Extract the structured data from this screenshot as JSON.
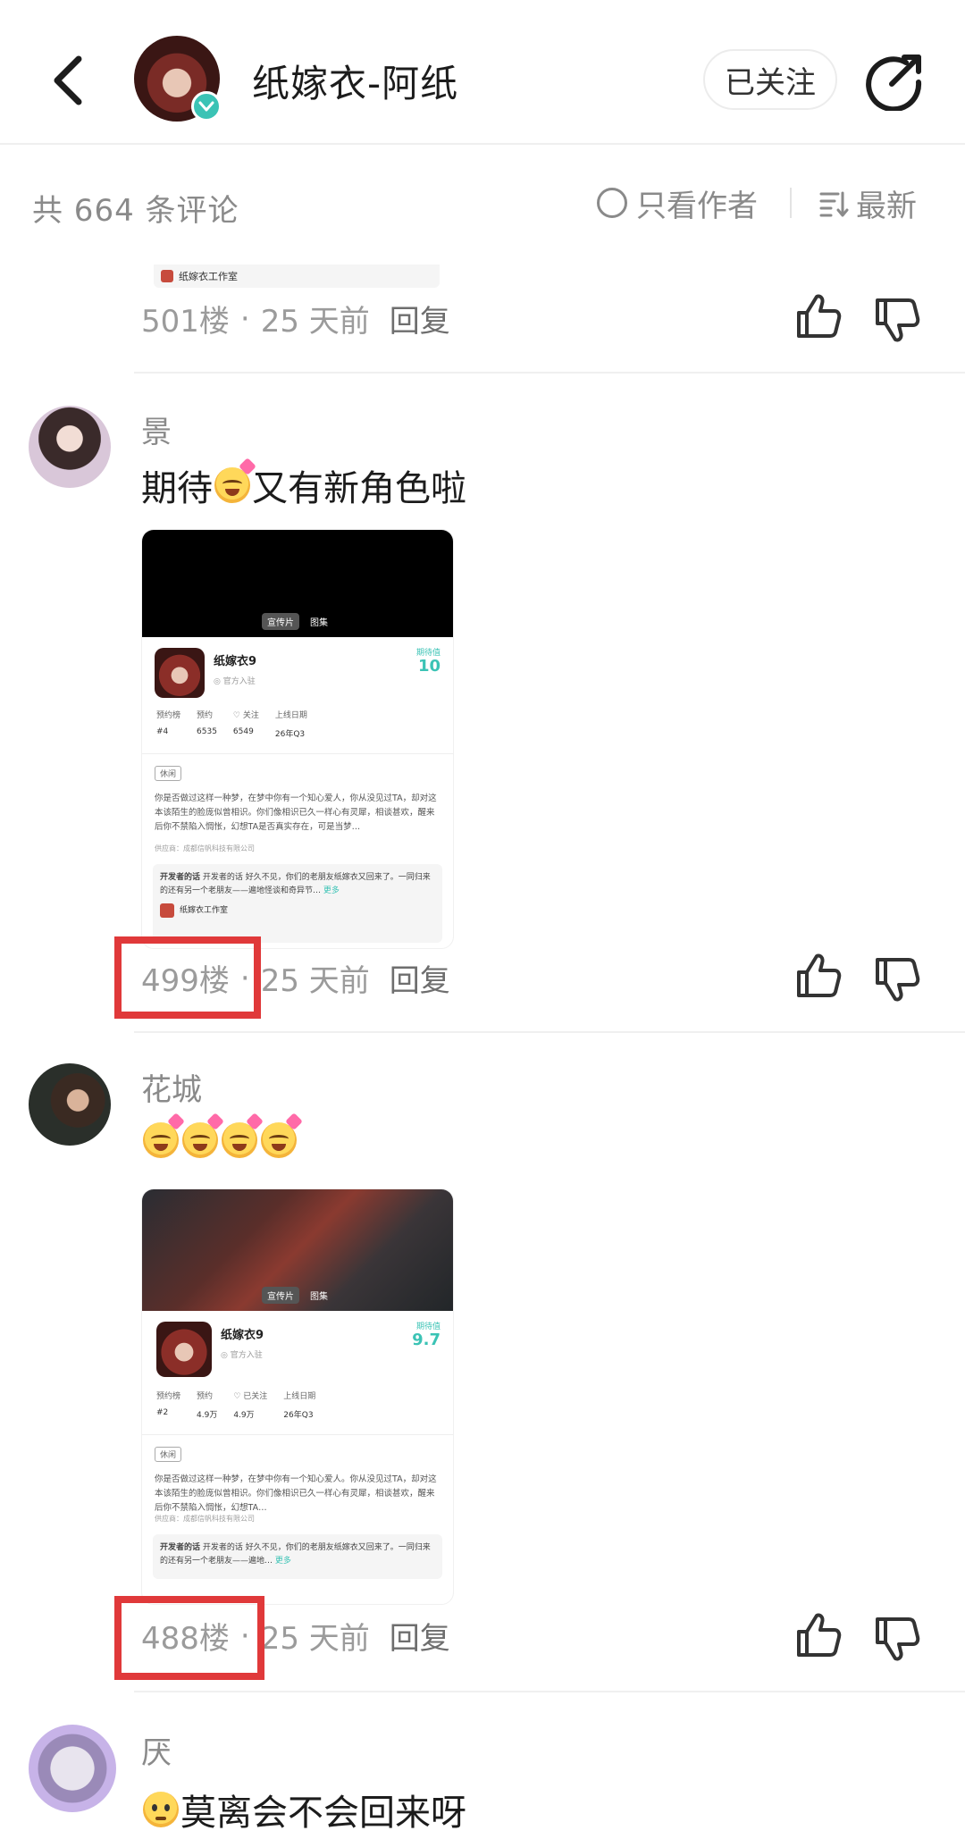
{
  "header": {
    "title": "纸嫁衣-阿纸",
    "follow_label": "已关注"
  },
  "filter_bar": {
    "count_text": "共 664 条评论",
    "author_only_label": "只看作者",
    "sort_label": "最新"
  },
  "top_partial": {
    "studio": "纸嫁衣工作室",
    "floor": "501楼",
    "time": "25 天前",
    "reply_label": "回复"
  },
  "comments": [
    {
      "username": "景",
      "text": "期待",
      "text_after": "又有新角色啦",
      "floor": "499楼",
      "time": "25 天前",
      "reply_label": "回复",
      "card": {
        "tabs": [
          "宣传片",
          "图集"
        ],
        "app_name": "纸嫁衣9",
        "official": "官方入驻",
        "score_label": "期待值",
        "score": "10",
        "stats": [
          {
            "label": "预约榜",
            "value": "#4"
          },
          {
            "label": "预约",
            "value": "6535"
          },
          {
            "label": "关注",
            "value": "6549"
          },
          {
            "label": "上线日期",
            "value": "26年Q3"
          }
        ],
        "genre": "休闲",
        "description": "你是否做过这样一种梦，在梦中你有一个知心爱人，你从没见过TA，却对这本该陌生的脸庞似曾相识。你们像相识已久一样心有灵犀，相谈甚欢，醒来后你不禁陷入惆怅，幻想TA是否真实存在，可是当梦…",
        "supplier": "供应商：成都信帆科技有限公司",
        "dev_note_title": "开发者的话",
        "dev_note": "开发者的话 好久不见，你们的老朋友纸嫁衣又回来了。一同归来的还有另一个老朋友——遍地怪谈和奇异节…",
        "more_label": "更多",
        "studio": "纸嫁衣工作室"
      }
    },
    {
      "username": "花城",
      "floor": "488楼",
      "time": "25 天前",
      "reply_label": "回复",
      "card": {
        "tabs": [
          "宣传片",
          "图集"
        ],
        "app_name": "纸嫁衣9",
        "official": "官方入驻",
        "score_label": "期待值",
        "score": "9.7",
        "stats": [
          {
            "label": "预约榜",
            "value": "#2"
          },
          {
            "label": "预约",
            "value": "4.9万"
          },
          {
            "label": "已关注",
            "value": "4.9万"
          },
          {
            "label": "上线日期",
            "value": "26年Q3"
          }
        ],
        "genre": "休闲",
        "description": "你是否做过这样一种梦，在梦中你有一个知心爱人。你从没见过TA，却对这本该陌生的脸庞似曾相识。你们像相识已久一样心有灵犀，相谈甚欢，醒来后你不禁陷入惆怅，幻想TA…",
        "supplier": "供应商：成都信帆科技有限公司",
        "dev_note_title": "开发者的话",
        "dev_note": "开发者的话 好久不见，你们的老朋友纸嫁衣又回来了。一同归来的还有另一个老朋友——遍地…",
        "more_label": "更多"
      }
    },
    {
      "username": "厌",
      "text": "莫离会不会回来呀"
    }
  ],
  "colors": {
    "accent": "#3bc3b5",
    "highlight": "#e0393a",
    "muted": "#9b9b9b"
  }
}
